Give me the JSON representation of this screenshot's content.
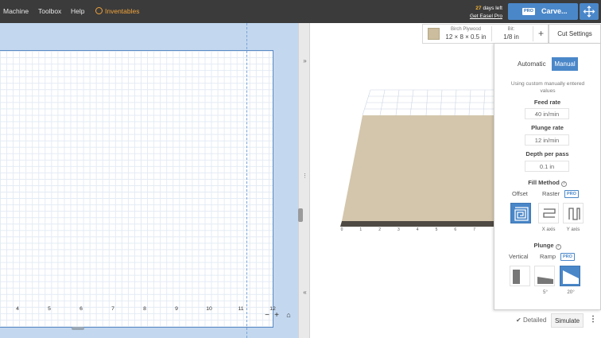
{
  "menu": {
    "machine": "Machine",
    "toolbox": "Toolbox",
    "help": "Help",
    "inventables": "Inventables"
  },
  "trial": {
    "days_number": "27",
    "days_text": "days left",
    "get_pro": "Get Easel Pro"
  },
  "carve_button": {
    "pro_badge": "PRO",
    "label": "Carve..."
  },
  "ruler": {
    "ticks": [
      "4",
      "5",
      "6",
      "7",
      "8",
      "9",
      "10",
      "11",
      "12"
    ]
  },
  "zoom": {
    "out": "−",
    "in": "+",
    "home": "⌂"
  },
  "splitter": {
    "top_arrow": "»",
    "bottom_arrow": "«"
  },
  "material": {
    "name": "Birch Plywood",
    "size": "12 × 8 × 0.5 in",
    "bit_label": "Bit:",
    "bit_value": "1/8 in",
    "add": "+"
  },
  "cut_settings": {
    "tab_label": "Cut Settings",
    "mode_automatic": "Automatic",
    "mode_manual": "Manual",
    "note": "Using custom manually entered values",
    "feed_rate_label": "Feed rate",
    "feed_rate_value": "40 in/min",
    "plunge_rate_label": "Plunge rate",
    "plunge_rate_value": "12 in/min",
    "depth_label": "Depth per pass",
    "depth_value": "0.1 in",
    "fill_method_label": "Fill Method",
    "fill_offset": "Offset",
    "fill_raster": "Raster",
    "pro_tag": "PRO",
    "fill_x_axis": "X axis",
    "fill_y_axis": "Y axis",
    "plunge_label": "Plunge",
    "plunge_vertical": "Vertical",
    "plunge_ramp": "Ramp",
    "ramp_5": "5°",
    "ramp_20": "20°",
    "help_glyph": "?"
  },
  "viewport_axis": {
    "ticks": [
      "0",
      "1",
      "2",
      "3",
      "4",
      "5",
      "6",
      "7"
    ]
  },
  "bottom": {
    "detailed": "Detailed",
    "simulate": "Simulate",
    "more": "⋮"
  },
  "colors": {
    "accent": "#4a87c9",
    "topbar": "#3b3b3b",
    "inventables": "#f0a23a",
    "wood_top": "#d3c6ac",
    "wood_edge": "#4f4a43"
  }
}
